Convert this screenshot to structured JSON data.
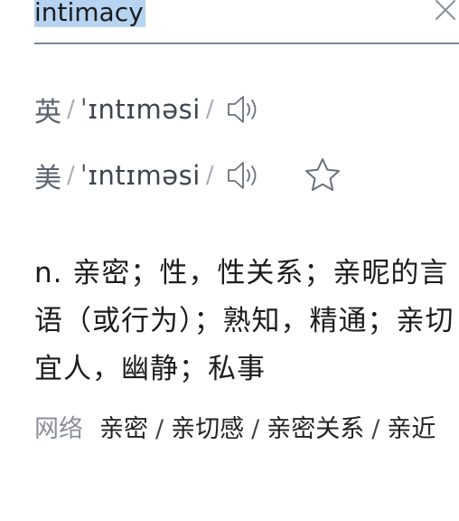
{
  "search": {
    "value": "intimacy"
  },
  "pronunciations": [
    {
      "region": "英",
      "ipa": "ˈɪntɪməsi"
    },
    {
      "region": "美",
      "ipa": "ˈɪntɪməsi"
    }
  ],
  "slash": "/",
  "definition": "n. 亲密；性，性关系；亲昵的言语（或行为）；熟知，精通；亲切宜人，幽静；私事",
  "web": {
    "label": "网络",
    "items": [
      "亲密",
      "亲切感",
      "亲密关系",
      "亲近"
    ],
    "separator": "/"
  },
  "icons": {
    "clear": "close-icon",
    "audio": "speaker-icon",
    "favorite": "star-icon"
  },
  "colors": {
    "selection": "#b7d3f2",
    "underline": "#7d8394",
    "muted": "#8a8f99"
  }
}
